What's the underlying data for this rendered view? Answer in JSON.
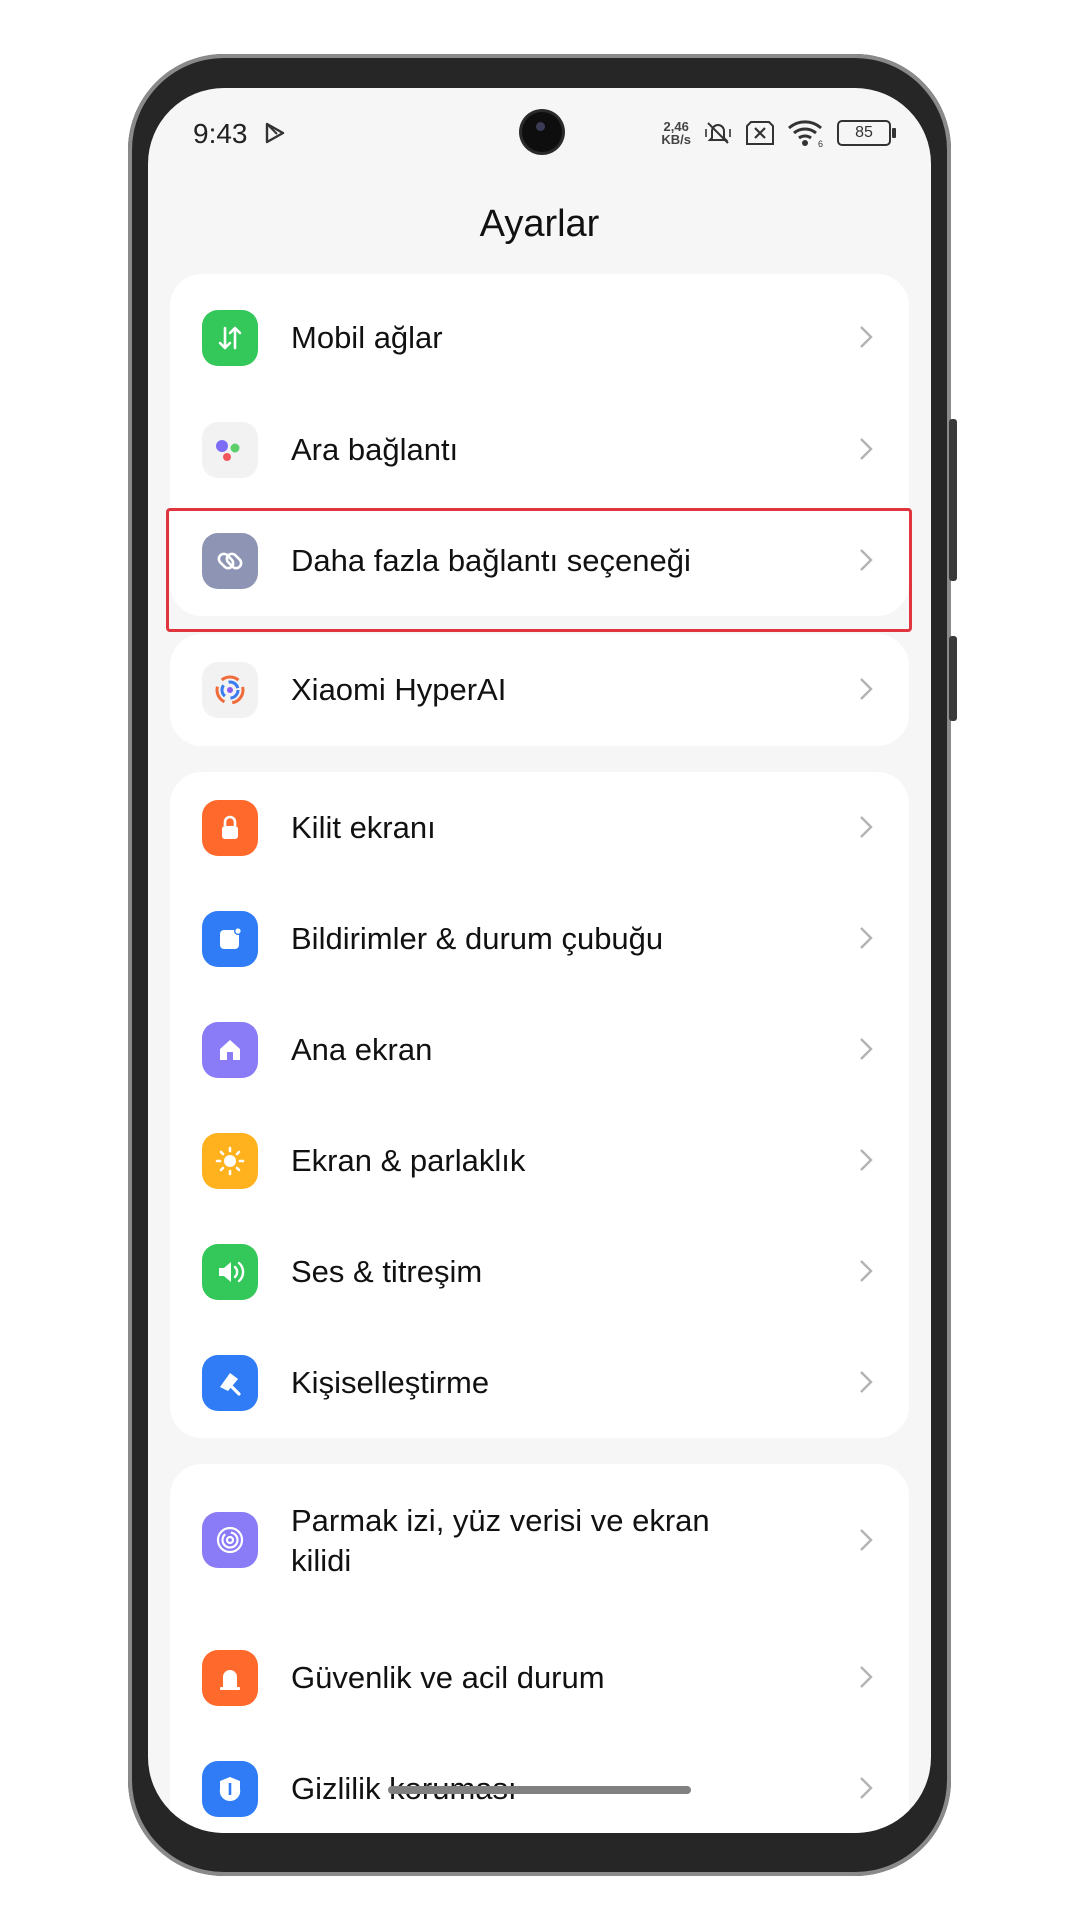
{
  "status_bar": {
    "time": "9:43",
    "net_speed_value": "2,46",
    "net_speed_unit": "KB/s",
    "battery": "85",
    "wifi_sub": "6"
  },
  "header": {
    "title": "Ayarlar"
  },
  "groups": [
    {
      "items": [
        {
          "label": "Mobil ağlar",
          "icon": "mobile-data-icon",
          "color": "#34c759"
        },
        {
          "label": "Ara bağlantı",
          "icon": "dots-icon",
          "color": "#f2f2f2"
        },
        {
          "label": "Daha fazla bağlantı seçeneği",
          "icon": "link-icon",
          "color": "#8e94b4"
        }
      ]
    },
    {
      "items": [
        {
          "label": "Xiaomi HyperAI",
          "icon": "hyperai-icon",
          "color": "#f2f2f2"
        }
      ]
    },
    {
      "items": [
        {
          "label": "Kilit ekranı",
          "icon": "lock-icon",
          "color": "#ff6a2c"
        },
        {
          "label": "Bildirimler & durum çubuğu",
          "icon": "notification-icon",
          "color": "#2f7cf6"
        },
        {
          "label": "Ana ekran",
          "icon": "home-icon",
          "color": "#8a7cf7"
        },
        {
          "label": "Ekran & parlaklık",
          "icon": "sun-icon",
          "color": "#ffb21e"
        },
        {
          "label": "Ses & titreşim",
          "icon": "speaker-icon",
          "color": "#34c759"
        },
        {
          "label": "Kişiselleştirme",
          "icon": "brush-icon",
          "color": "#2f7cf6"
        }
      ]
    },
    {
      "items": [
        {
          "label": "Parmak izi, yüz verisi ve ekran kilidi",
          "icon": "fingerprint-icon",
          "color": "#8a7cf7"
        },
        {
          "label": "Güvenlik ve acil durum",
          "icon": "security-icon",
          "color": "#ff6a2c"
        },
        {
          "label": "Gizlilik koruması",
          "icon": "privacy-icon",
          "color": "#2f7cf6"
        }
      ]
    }
  ],
  "highlight_color": "#e0353f"
}
